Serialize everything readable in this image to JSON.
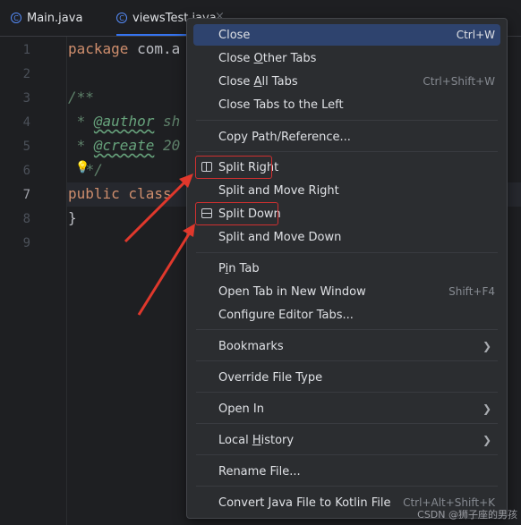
{
  "tabs": [
    {
      "label": "Main.java",
      "icon": "java-class-icon"
    },
    {
      "label": "viewsTest.java",
      "icon": "java-class-icon",
      "active": true
    }
  ],
  "tab_close": "×",
  "line_numbers": [
    "1",
    "2",
    "3",
    "4",
    "5",
    "6",
    "7",
    "8",
    "9"
  ],
  "code": {
    "line1_kw": "package",
    "line1_rest": " com.a",
    "line3": "/**",
    "line4_star": " * ",
    "line4_tag": "@author",
    "line4_rest": " sh",
    "line5_star": " * ",
    "line5_tag": "@create",
    "line5_rest": " 20",
    "line6": " */",
    "line7_kw": "public class",
    "line8": "}"
  },
  "menu": {
    "close": {
      "label": "Close",
      "shortcut": "Ctrl+W"
    },
    "close_other_pre": "Close ",
    "close_other_u": "O",
    "close_other_post": "ther Tabs",
    "close_all_pre": "Close ",
    "close_all_u": "A",
    "close_all_post": "ll Tabs",
    "close_all_shortcut": "Ctrl+Shift+W",
    "close_left": "Close Tabs to the Left",
    "copy_path": "Copy Path/Reference...",
    "split_right": "Split Right",
    "split_move_right": "Split and Move Right",
    "split_down": "Split Down",
    "split_move_down": "Split and Move Down",
    "pin_pre": "P",
    "pin_u": "i",
    "pin_post": "n Tab",
    "open_new_window": {
      "label": "Open Tab in New Window",
      "shortcut": "Shift+F4"
    },
    "configure_tabs": "Configure Editor Tabs...",
    "bookmarks": "Bookmarks",
    "override_type": "Override File Type",
    "open_in": "Open In",
    "local_history_pre": "Local ",
    "local_history_u": "H",
    "local_history_post": "istory",
    "rename": "Rename File...",
    "convert": {
      "label": "Convert Java File to Kotlin File",
      "shortcut": "Ctrl+Alt+Shift+K"
    }
  },
  "watermark": "CSDN @狮子座的男孩",
  "colors": {
    "selection": "#2e436e",
    "highlight_box": "#d03030",
    "arrow": "#e0382c"
  }
}
